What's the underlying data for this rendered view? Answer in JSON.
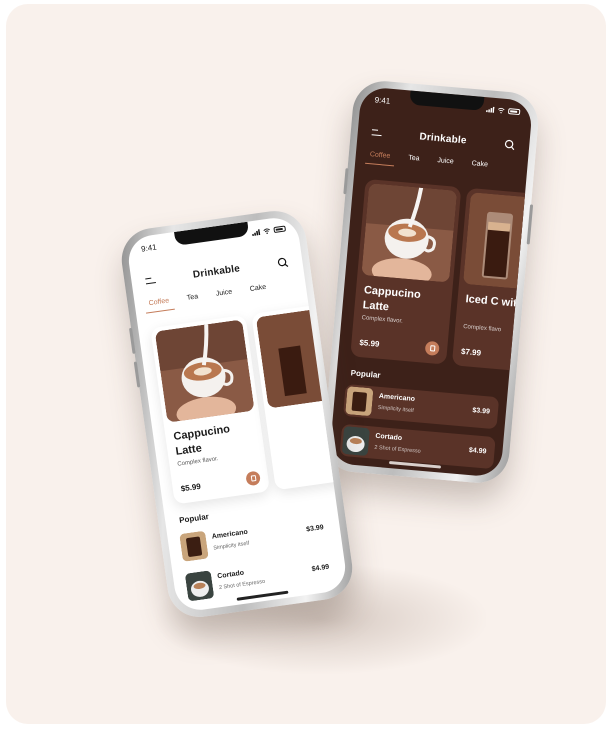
{
  "colors": {
    "accent": "#c57d5b",
    "dark_bg": "#3d2119",
    "dark_card": "#5a3328",
    "page_bg": "#f9f1ec"
  },
  "back_phone": {
    "status": {
      "time": "9:41"
    },
    "app_title": "Drinkable",
    "tabs": [
      {
        "label": "Coffee"
      },
      {
        "label": "Tea"
      },
      {
        "label": "Juice"
      },
      {
        "label": "Cake"
      }
    ],
    "cards": [
      {
        "name": "Cappucino Latte",
        "desc": "Complex flavor.",
        "price": "$5.99"
      },
      {
        "name": "Iced C with M",
        "desc": "Complex flavo",
        "price": "$7.99"
      }
    ],
    "section_title": "Popular",
    "popular": [
      {
        "name": "Americano",
        "desc": "Simplicity itself",
        "price": "$3.99"
      },
      {
        "name": "Cortado",
        "desc": "2 Shot of Espresso",
        "price": "$4.99"
      }
    ]
  },
  "front_phone": {
    "status": {
      "time": "9:41"
    },
    "app_title": "Drinkable",
    "tabs": [
      {
        "label": "Coffee"
      },
      {
        "label": "Tea"
      },
      {
        "label": "Juice"
      },
      {
        "label": "Cake"
      }
    ],
    "cards": [
      {
        "name": "Cappucino Latte",
        "desc": "Complex flavor.",
        "price": "$5.99"
      }
    ],
    "section_title": "Popular",
    "popular": [
      {
        "name": "Americano",
        "desc": "Simplicity itself",
        "price": "$3.99"
      },
      {
        "name": "Cortado",
        "desc": "2 Shot of Espresso",
        "price": "$4.99"
      }
    ]
  }
}
